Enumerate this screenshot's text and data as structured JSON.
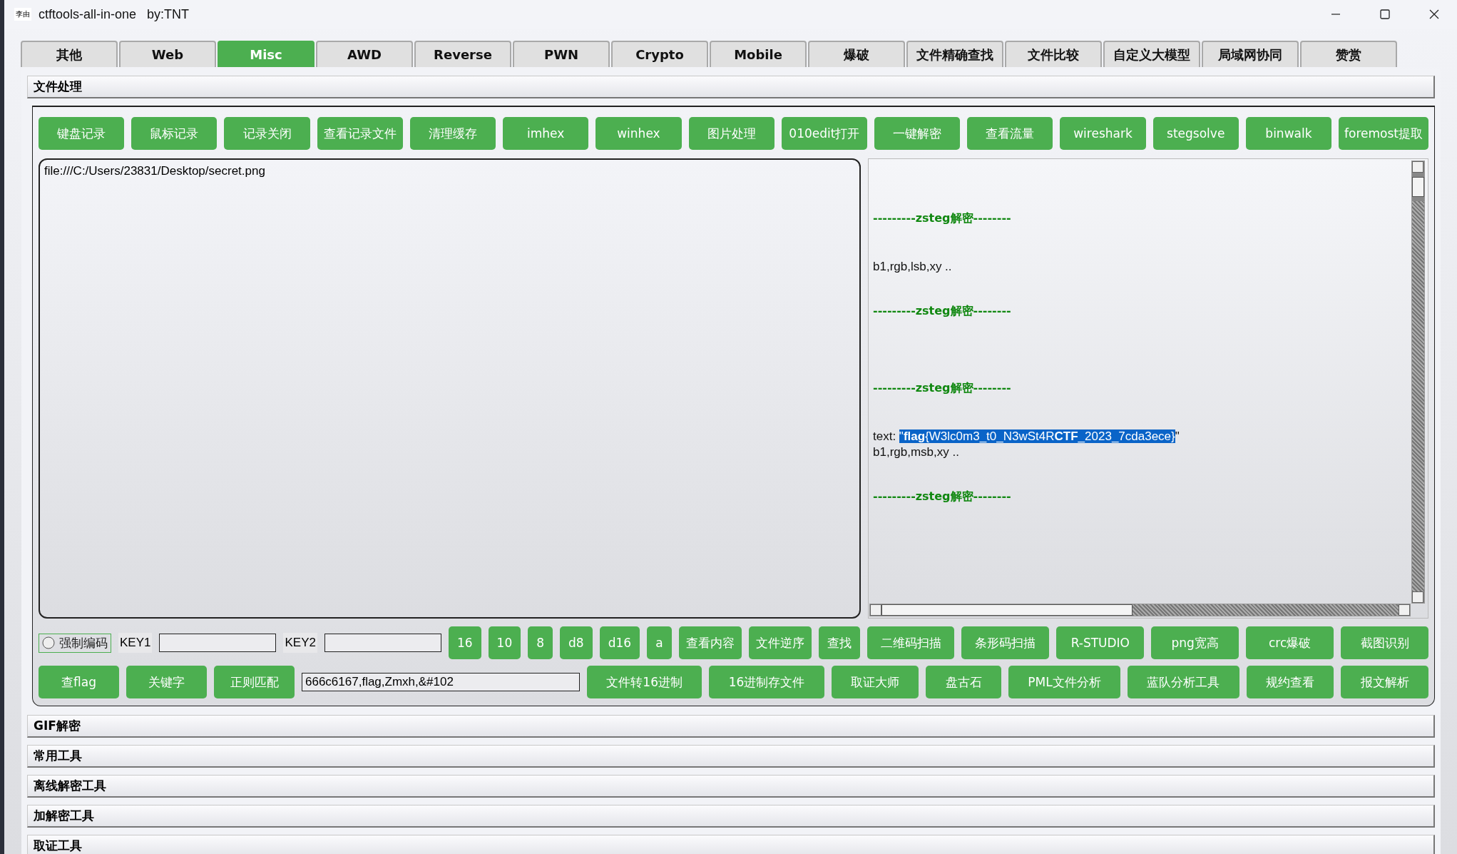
{
  "window": {
    "icon_text": "李由",
    "title": "ctftools-all-in-one   by:TNT"
  },
  "tabs": [
    {
      "label": "其他",
      "selected": false
    },
    {
      "label": "Web",
      "selected": false
    },
    {
      "label": "Misc",
      "selected": true
    },
    {
      "label": "AWD",
      "selected": false
    },
    {
      "label": "Reverse",
      "selected": false
    },
    {
      "label": "PWN",
      "selected": false
    },
    {
      "label": "Crypto",
      "selected": false
    },
    {
      "label": "Mobile",
      "selected": false
    },
    {
      "label": "爆破",
      "selected": false
    },
    {
      "label": "文件精确查找",
      "selected": false
    },
    {
      "label": "文件比较",
      "selected": false
    },
    {
      "label": "自定义大模型",
      "selected": false
    },
    {
      "label": "局域网协同",
      "selected": false
    },
    {
      "label": "赞赏",
      "selected": false
    }
  ],
  "section": {
    "title": "文件处理"
  },
  "toolbar": [
    "键盘记录",
    "鼠标记录",
    "记录关闭",
    "查看记录文件",
    "清理缓存",
    "imhex",
    "winhex",
    "图片处理",
    "010edit打开",
    "一键解密",
    "查看流量",
    "wireshark",
    "stegsolve",
    "binwalk",
    "foremost提取"
  ],
  "file_path": "file:///C:/Users/23831/Desktop/secret.png",
  "output": [
    {
      "kind": "header",
      "text": "---------zsteg解密--------"
    },
    {
      "kind": "text",
      "text": "b1,rgb,lsb,xy .."
    },
    {
      "kind": "header",
      "text": "---------zsteg解密--------"
    },
    {
      "kind": "header",
      "text": "---------zsteg解密--------"
    },
    {
      "kind": "selected",
      "prefix": "text: ",
      "selection": "\"**flag**{W3lc0m3_t0_N3wSt4R**CTF**_2023_7cda3ece}",
      "suffix": "\""
    },
    {
      "kind": "text",
      "text": "b1,rgb,msb,xy .."
    },
    {
      "kind": "header",
      "text": "---------zsteg解密--------"
    }
  ],
  "options": {
    "force_encoding": {
      "label": "强制编码",
      "checked": false
    },
    "key1_label": "KEY1",
    "key2_label": "KEY2"
  },
  "row2_buttons": [
    {
      "label": "16",
      "kind": "small"
    },
    {
      "label": "10",
      "kind": "small"
    },
    {
      "label": "8",
      "kind": "small"
    },
    {
      "label": "d8",
      "kind": "small"
    },
    {
      "label": "d16",
      "kind": "small"
    },
    {
      "label": "a",
      "kind": "small"
    },
    {
      "label": "查看内容",
      "kind": "mid"
    },
    {
      "label": "文件逆序",
      "kind": "mid"
    },
    {
      "label": "查找",
      "kind": "small"
    },
    {
      "label": "二维码扫描",
      "kind": "wide"
    },
    {
      "label": "条形码扫描",
      "kind": "wide"
    },
    {
      "label": "R-STUDIO",
      "kind": "wide"
    },
    {
      "label": "png宽高",
      "kind": "wide"
    },
    {
      "label": "crc爆破",
      "kind": "wide"
    },
    {
      "label": "截图识别",
      "kind": "wide"
    }
  ],
  "row3_left": [
    "查flag",
    "关键字",
    "正则匹配"
  ],
  "search_value": "666c6167,flag,Zmxh,&#102",
  "row3_right": [
    "文件转16进制",
    "16进制存文件",
    "取证大师",
    "盘古石",
    "PML文件分析",
    "蓝队分析工具",
    "规约查看",
    "报文解析"
  ],
  "panels": [
    "GIF解密",
    "常用工具",
    "离线解密工具",
    "加解密工具",
    "取证工具"
  ]
}
